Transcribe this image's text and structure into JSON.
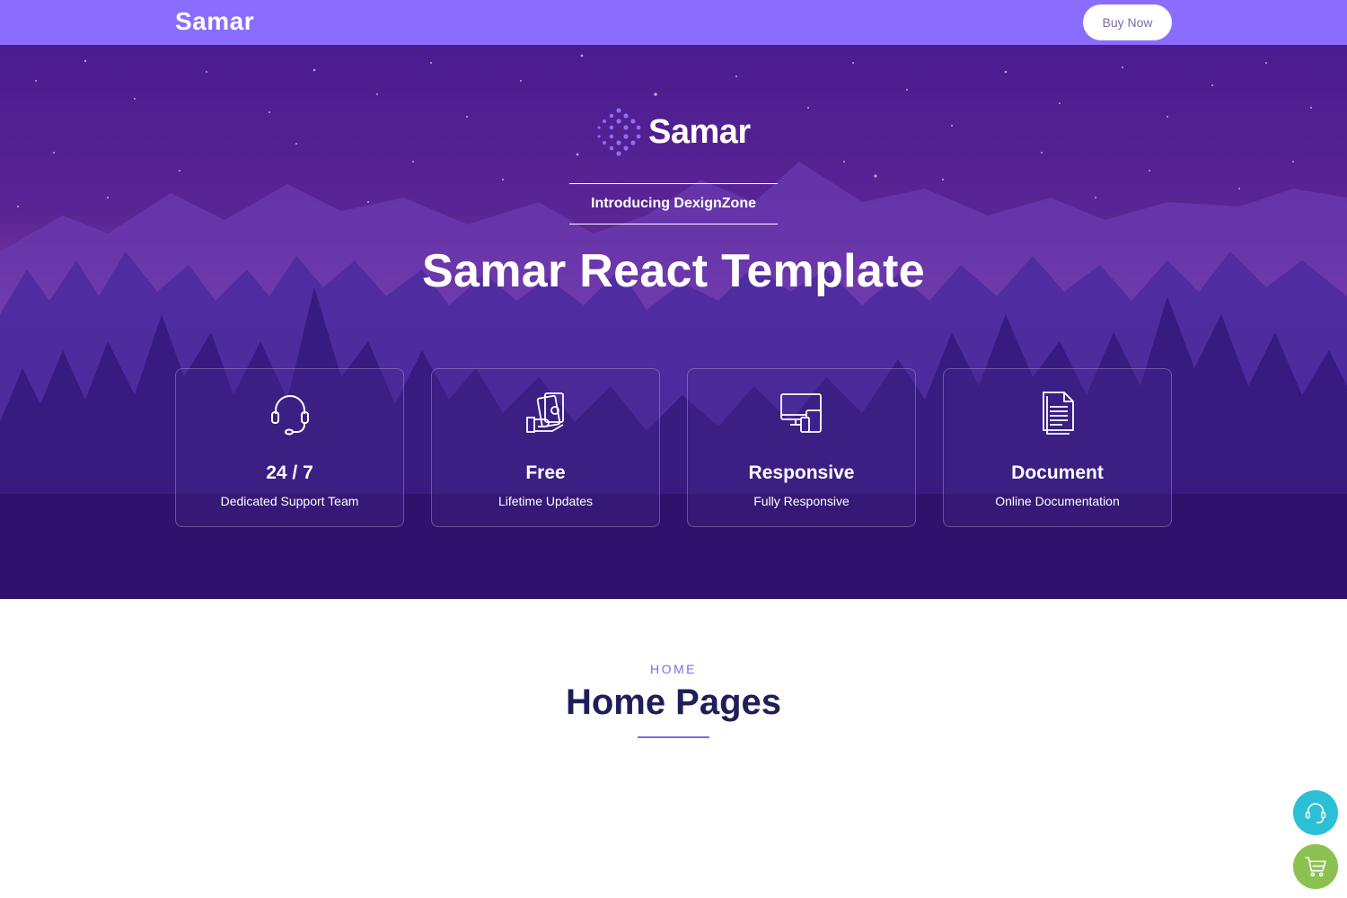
{
  "topbar": {
    "brand": "Samar",
    "buy_label": "Buy Now"
  },
  "hero": {
    "logo_name": "Samar",
    "intro": "Introducing DexignZone",
    "title": "Samar React Template",
    "cards": [
      {
        "icon": "headset-icon",
        "title": "24 / 7",
        "subtitle": "Dedicated Support Team"
      },
      {
        "icon": "money-hand-icon",
        "title": "Free",
        "subtitle": "Lifetime Updates"
      },
      {
        "icon": "devices-icon",
        "title": "Responsive",
        "subtitle": "Fully Responsive"
      },
      {
        "icon": "document-icon",
        "title": "Document",
        "subtitle": "Online Documentation"
      }
    ]
  },
  "section": {
    "label": "HOME",
    "title": "Home Pages"
  },
  "floating": [
    {
      "icon": "headset-icon",
      "color": "#2bc0d8"
    },
    {
      "icon": "cart-icon",
      "color": "#8cc152"
    }
  ],
  "colors": {
    "topbar": "#8a6cff",
    "hero_dark": "#2c0e5c",
    "accent": "#7b6cf0",
    "heading": "#1e1e5a"
  }
}
